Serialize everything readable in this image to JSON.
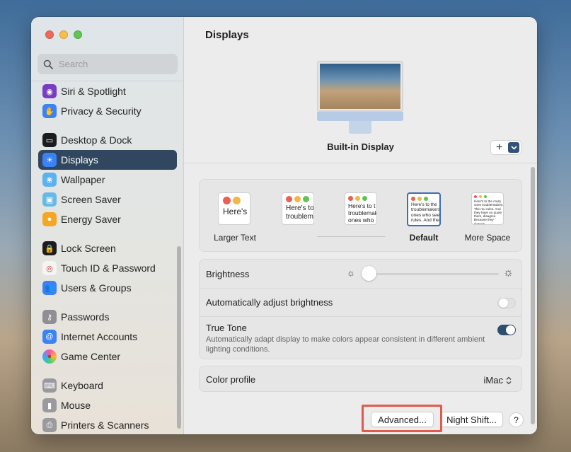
{
  "window": {
    "traffic_lights": [
      "close",
      "minimize",
      "zoom"
    ]
  },
  "search": {
    "placeholder": "Search"
  },
  "sidebar": {
    "groups": [
      [
        {
          "label": "Siri & Spotlight",
          "icon": "siri-icon",
          "color": "#7a3cc4"
        },
        {
          "label": "Privacy & Security",
          "icon": "hand-icon",
          "color": "#3b82f6"
        }
      ],
      [
        {
          "label": "Desktop & Dock",
          "icon": "dock-icon",
          "color": "#1c1c1e"
        },
        {
          "label": "Displays",
          "icon": "displays-sun-icon",
          "color": "#3b82f6",
          "active": true
        },
        {
          "label": "Wallpaper",
          "icon": "wallpaper-icon",
          "color": "#5ab3f0"
        },
        {
          "label": "Screen Saver",
          "icon": "screen-saver-icon",
          "color": "#67b9e8"
        },
        {
          "label": "Energy Saver",
          "icon": "lightbulb-icon",
          "color": "#f5a623"
        }
      ],
      [
        {
          "label": "Lock Screen",
          "icon": "lock-icon",
          "color": "#1c1c1e"
        },
        {
          "label": "Touch ID & Password",
          "icon": "fingerprint-icon",
          "color": "#f4f4f4"
        },
        {
          "label": "Users & Groups",
          "icon": "users-icon",
          "color": "#3b82f6"
        }
      ],
      [
        {
          "label": "Passwords",
          "icon": "key-icon",
          "color": "#8e8e93"
        },
        {
          "label": "Internet Accounts",
          "icon": "at-icon",
          "color": "#3b82f6"
        },
        {
          "label": "Game Center",
          "icon": "game-center-icon",
          "color": "#ffffff"
        }
      ],
      [
        {
          "label": "Keyboard",
          "icon": "keyboard-icon",
          "color": "#9a9a9e"
        },
        {
          "label": "Mouse",
          "icon": "mouse-icon",
          "color": "#9a9a9e"
        },
        {
          "label": "Printers & Scanners",
          "icon": "printer-icon",
          "color": "#9a9a9e"
        }
      ]
    ]
  },
  "main": {
    "title": "Displays",
    "display_name": "Built-in Display",
    "add_button": "+",
    "resolution": {
      "options": [
        {
          "label": "Larger Text",
          "sample": "Here's"
        },
        {
          "label": "",
          "sample": "Here's to troublem"
        },
        {
          "label": "",
          "sample": "Here's to t troublemake ones who"
        },
        {
          "label": "Default",
          "sample": "Here's to the troublemakers. ones who see t rules. And the",
          "selected": true
        },
        {
          "label": "More Space",
          "sample": "Here's to the crazy ones troublemakers. The rou rules. And they have no quote them, disagree Because they change"
        }
      ]
    },
    "brightness": {
      "label": "Brightness",
      "level": 0.0
    },
    "auto_brightness": {
      "label": "Automatically adjust brightness",
      "enabled": false
    },
    "true_tone": {
      "label": "True Tone",
      "description": "Automatically adapt display to make colors appear consistent in different ambient lighting conditions.",
      "enabled": true
    },
    "color_profile": {
      "label": "Color profile",
      "value": "iMac"
    },
    "buttons": {
      "advanced": "Advanced...",
      "night_shift": "Night Shift...",
      "help": "?"
    }
  }
}
